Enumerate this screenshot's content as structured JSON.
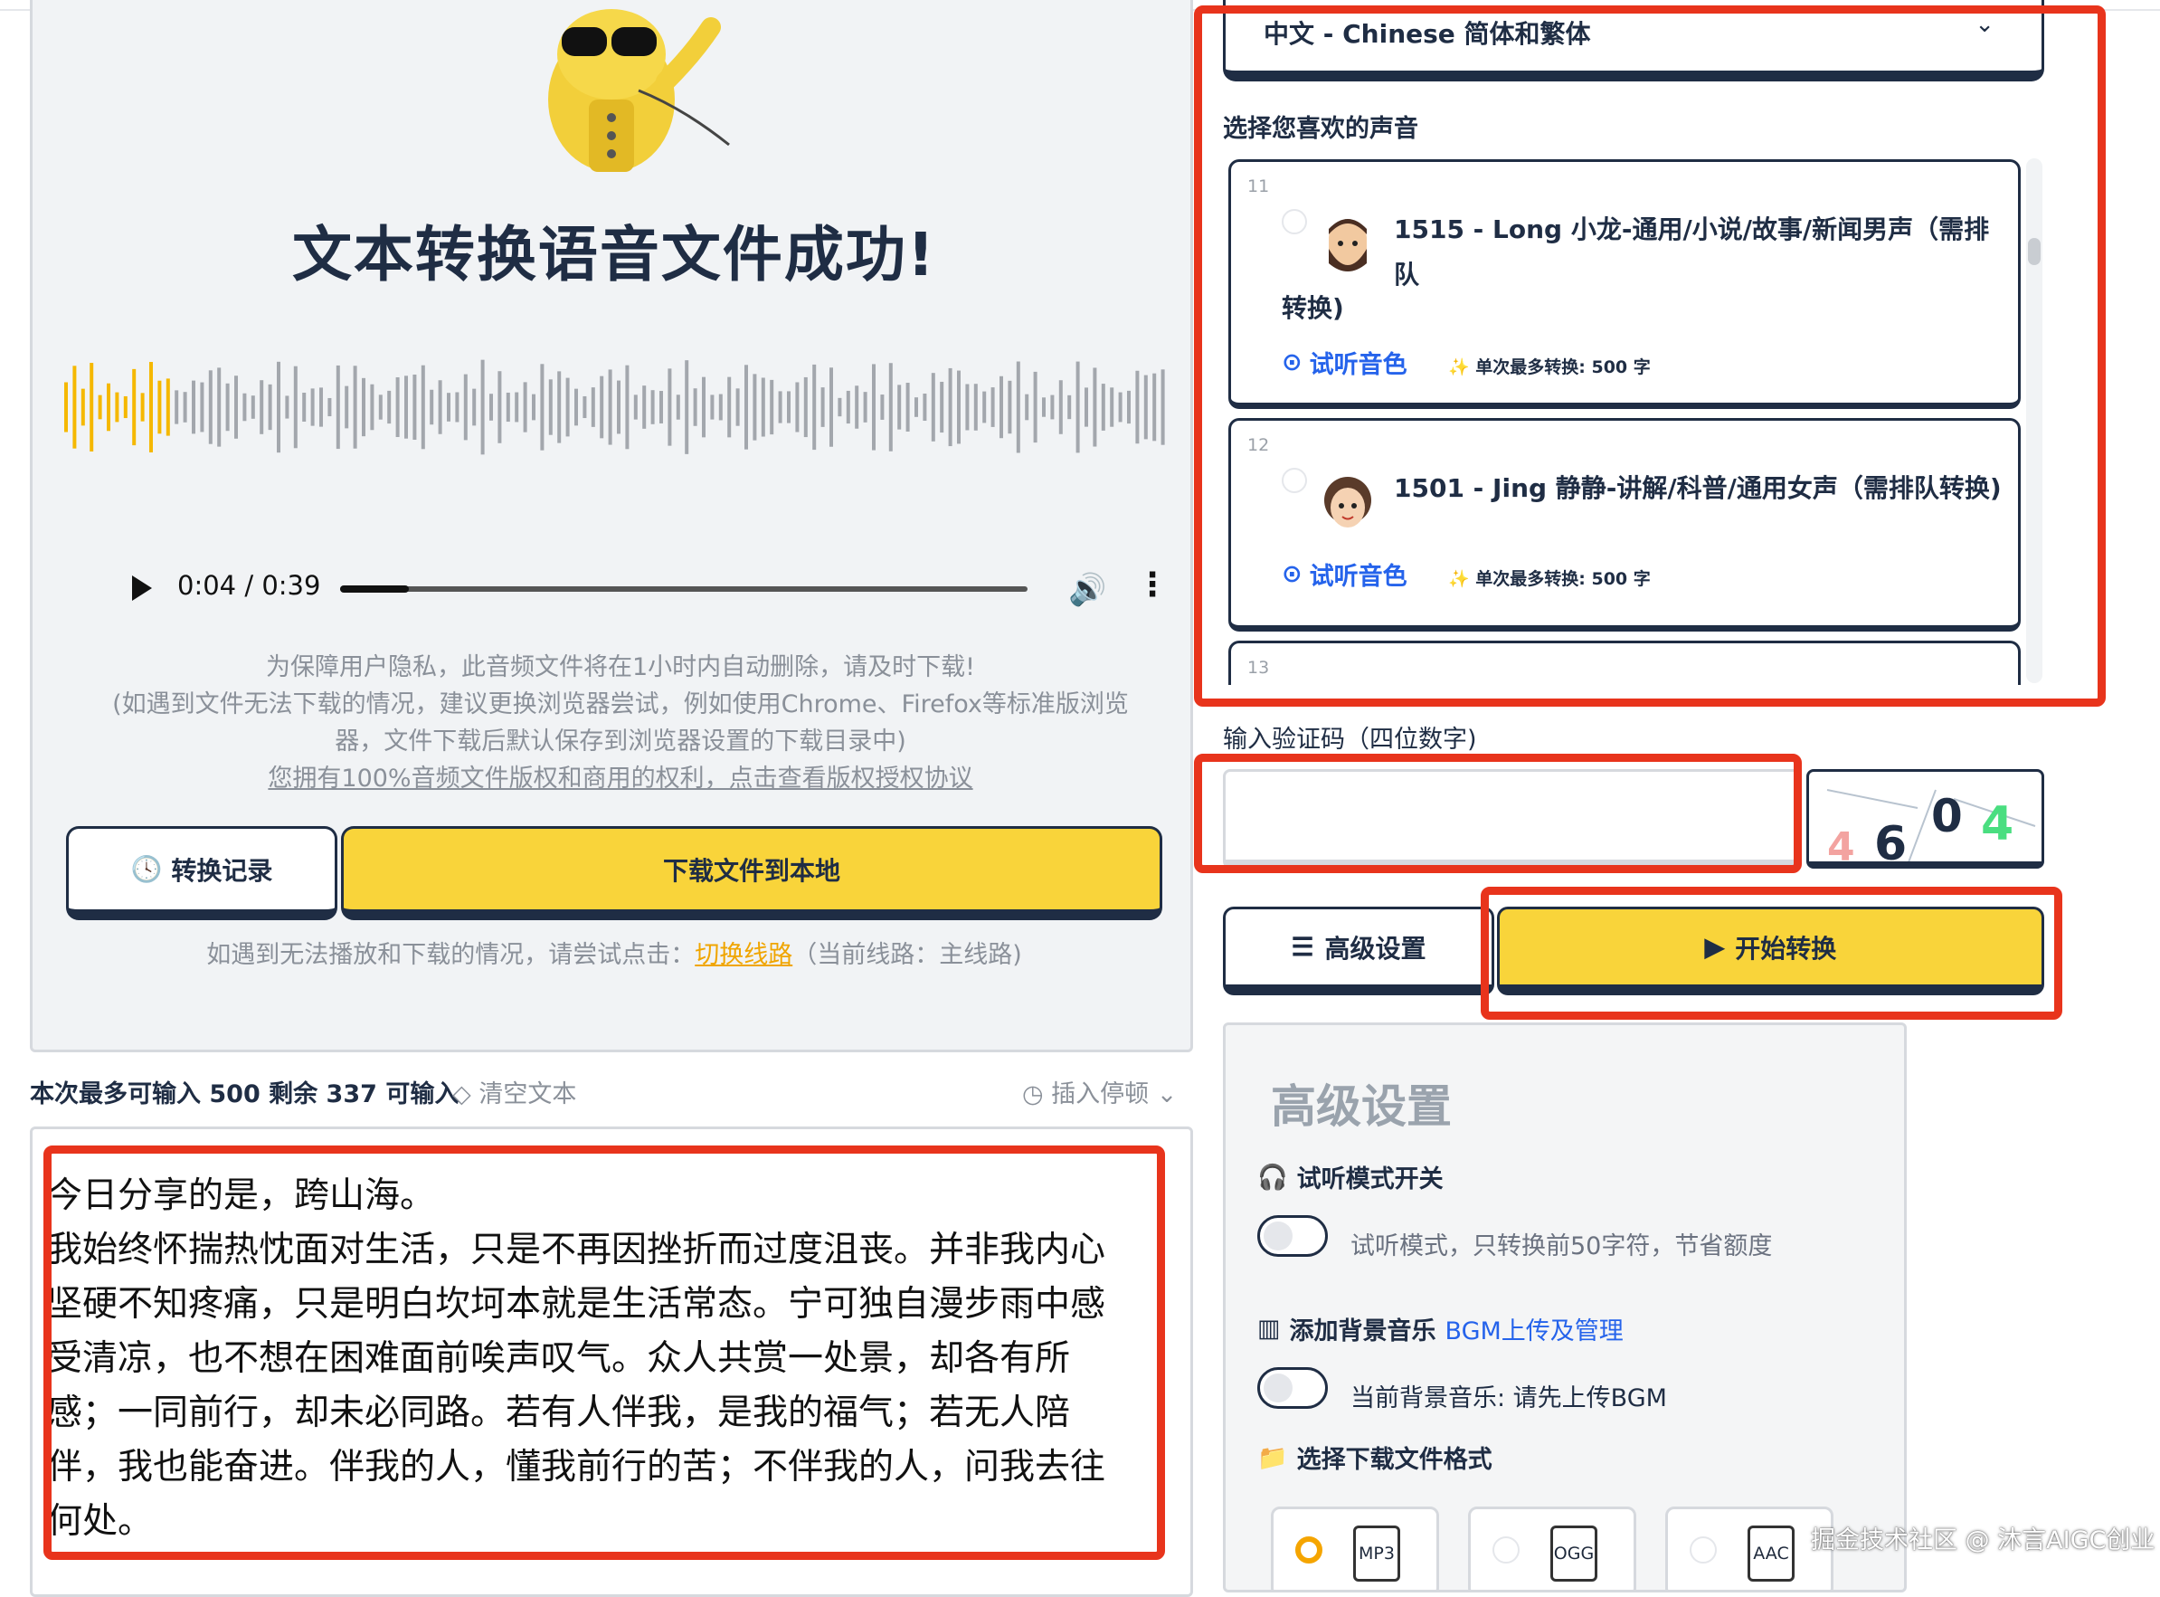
{
  "result": {
    "title": "文本转换语音文件成功!",
    "player": {
      "time": "0:04 / 0:39",
      "progress_fraction": 0.1
    },
    "notes": [
      "为保障用户隐私，此音频文件将在1小时内自动删除，请及时下载!",
      "(如遇到文件无法下载的情况，建议更换浏览器尝试，例如使用Chrome、Firefox等标准版浏览",
      "器，文件下载后默认保存到浏览器设置的下载目录中)"
    ],
    "license_link": "您拥有100%音频文件版权和商用的权利，点击查看版权授权协议",
    "history_button": "转换记录",
    "download_button": "下载文件到本地",
    "switch_prefix": "如遇到无法播放和下载的情况，请尝试点击：",
    "switch_link": "切换线路",
    "switch_suffix": "（当前线路：主线路)",
    "accent_color": "#f9d43a"
  },
  "editor": {
    "counter": "本次最多可输入 500 剩余 337 可输入",
    "clear": "清空文本",
    "insert_pause": "插入停顿",
    "text": "今日分享的是，跨山海。\n我始终怀揣热忱面对生活，只是不再因挫折而过度沮丧。并非我内心坚硬不知疼痛，只是明白坎坷本就是生活常态。宁可独自漫步雨中感受清凉，也不想在困难面前唉声叹气。众人共赏一处景，却各有所感；一同前行，却未必同路。若有人伴我，是我的福气；若无人陪伴，我也能奋进。伴我的人，懂我前行的苦；不伴我的人，问我去往何处。"
  },
  "settings": {
    "language": "中文 - Chinese 简体和繁体",
    "voice_label": "选择您喜欢的声音",
    "voices": [
      {
        "index": "11",
        "name_line1": "1515 - Long 小龙-通用/小说/故事/新闻男声（需排队",
        "name_line2": "转换)",
        "listen": "试听音色",
        "limit": "单次最多转换: 500 字"
      },
      {
        "index": "12",
        "name_line1": "1501 - Jing 静静-讲解/科普/通用女声（需排队转换)",
        "listen": "试听音色",
        "limit": "单次最多转换: 500 字"
      },
      {
        "index": "13"
      }
    ],
    "captcha_label": "输入验证码（四位数字)",
    "captcha_value": "",
    "captcha_digits": [
      "4",
      "6",
      "0",
      "4"
    ],
    "advanced_button": "高级设置",
    "start_button": "开始转换"
  },
  "advanced": {
    "title": "高级设置",
    "preview_mode_label": "试听模式开关",
    "preview_mode_text": "试听模式，只转换前50字符，节省额度",
    "bgm_label": "添加背景音乐",
    "bgm_link": "BGM上传及管理",
    "bgm_text": "当前背景音乐: 请先上传BGM",
    "format_label": "选择下载文件格式",
    "formats": [
      "MP3",
      "OGG",
      "AAC"
    ]
  },
  "watermark": "掘金技术社区 @ 沐言AIGC创业"
}
